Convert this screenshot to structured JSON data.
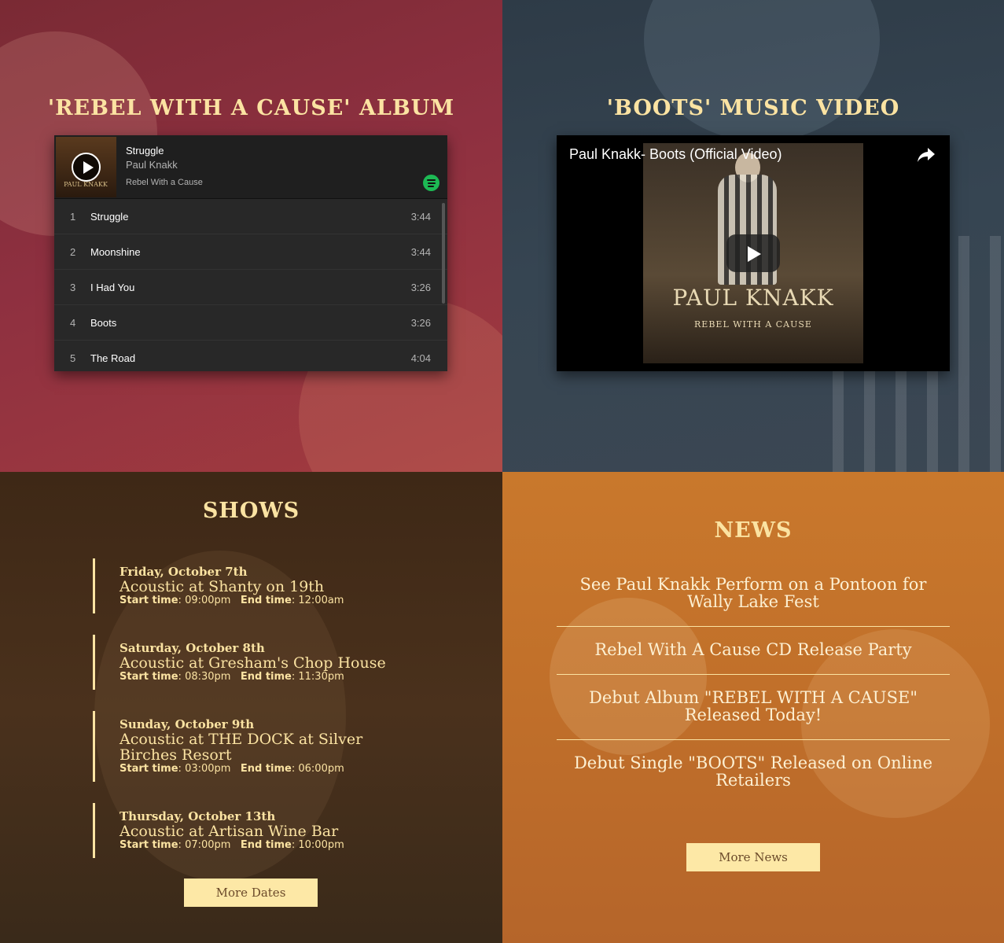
{
  "album": {
    "title": "'REBEL WITH A CAUSE' ALBUM",
    "player": {
      "track": "Struggle",
      "artist": "Paul Knakk",
      "album": "Rebel With a Cause",
      "cover_text": "PAUL KNAKK",
      "tracks": [
        {
          "num": "1",
          "name": "Struggle",
          "duration": "3:44"
        },
        {
          "num": "2",
          "name": "Moonshine",
          "duration": "3:44"
        },
        {
          "num": "3",
          "name": "I Had You",
          "duration": "3:26"
        },
        {
          "num": "4",
          "name": "Boots",
          "duration": "3:26"
        },
        {
          "num": "5",
          "name": "The Road",
          "duration": "4:04"
        }
      ]
    }
  },
  "video": {
    "title": "'BOOTS' MUSIC VIDEO",
    "video_title": "Paul Knakk- Boots (Official Video)",
    "thumb_brand": "PAUL KNAKK",
    "thumb_sub": "REBEL WITH A CAUSE"
  },
  "shows": {
    "title": "SHOWS",
    "start_label": "Start time",
    "end_label": "End time",
    "items": [
      {
        "date": "Friday, October 7th",
        "title": "Acoustic at Shanty on 19th",
        "start": "09:00pm",
        "end": "12:00am"
      },
      {
        "date": "Saturday, October 8th",
        "title": "Acoustic at Gresham's Chop House",
        "start": "08:30pm",
        "end": "11:30pm"
      },
      {
        "date": "Sunday, October 9th",
        "title": "Acoustic at THE DOCK at Silver Birches Resort",
        "start": "03:00pm",
        "end": "06:00pm"
      },
      {
        "date": "Thursday, October 13th",
        "title": "Acoustic at Artisan Wine Bar",
        "start": "07:00pm",
        "end": "10:00pm"
      }
    ],
    "more_label": "More Dates"
  },
  "news": {
    "title": "NEWS",
    "items": [
      "See Paul Knakk Perform on a Pontoon for Wally Lake Fest",
      "Rebel With A Cause CD Release Party",
      "Debut Album \"REBEL WITH A CAUSE\" Released Today!",
      "Debut Single \"BOOTS\" Released on Online Retailers"
    ],
    "more_label": "More News"
  },
  "colors": {
    "accent": "#fbe3a2",
    "button_bg": "#fde8a6",
    "spotify_green": "#1db954"
  }
}
